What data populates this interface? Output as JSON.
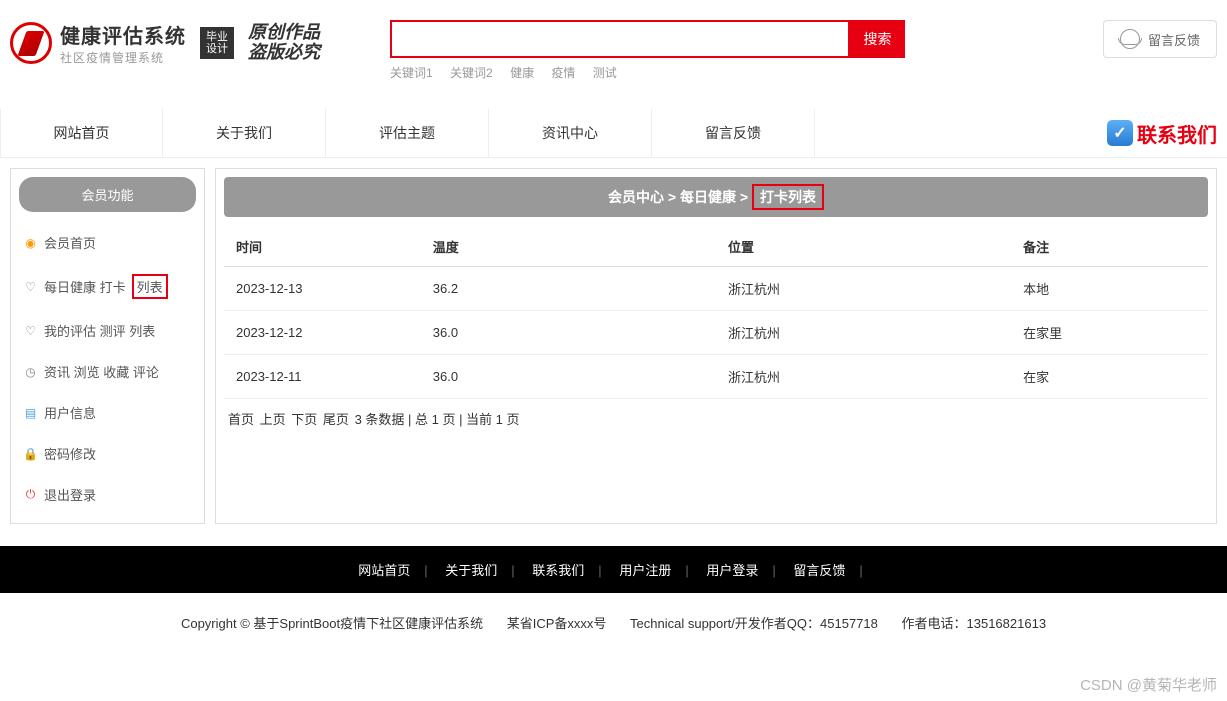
{
  "header": {
    "logo_title": "健康评估系统",
    "logo_sub": "社区疫情管理系统",
    "badge_line1": "毕业",
    "badge_line2": "设计",
    "calli_line1": "原创作品",
    "calli_line2": "盗版必究",
    "search_btn": "搜索",
    "search_placeholder": "",
    "keywords": [
      "关键词1",
      "关键词2",
      "健康",
      "疫情",
      "测试"
    ],
    "feedback": "留言反馈"
  },
  "nav": {
    "items": [
      "网站首页",
      "关于我们",
      "评估主题",
      "资讯中心",
      "留言反馈"
    ],
    "contact": "联系我们"
  },
  "sidebar": {
    "title": "会员功能",
    "items": [
      {
        "label": "会员首页"
      },
      {
        "label_pre": "每日健康 打卡",
        "label_box": "列表"
      },
      {
        "label": "我的评估 测评 列表"
      },
      {
        "label": "资讯 浏览 收藏 评论"
      },
      {
        "label": "用户信息"
      },
      {
        "label": "密码修改"
      },
      {
        "label": "退出登录"
      }
    ]
  },
  "breadcrumb": {
    "p1": "会员中心",
    "sep": " > ",
    "p2": "每日健康",
    "p3": "打卡列表"
  },
  "table": {
    "headers": [
      "时间",
      "温度",
      "位置",
      "备注"
    ],
    "rows": [
      [
        "2023-12-13",
        "36.2",
        "浙江杭州",
        "本地"
      ],
      [
        "2023-12-12",
        "36.0",
        "浙江杭州",
        "在家里"
      ],
      [
        "2023-12-11",
        "36.0",
        "浙江杭州",
        "在家"
      ]
    ]
  },
  "pager": {
    "first": "首页",
    "prev": "上页",
    "next": "下页",
    "last": "尾页",
    "info": "3 条数据 | 总 1 页 | 当前 1 页"
  },
  "footer": {
    "links": [
      "网站首页",
      "关于我们",
      "联系我们",
      "用户注册",
      "用户登录",
      "留言反馈"
    ],
    "copy_pre": "Copyright © 基于SprintBoot疫情下社区健康评估系统",
    "icp": "某省ICP备xxxx号",
    "support": "Technical support/开发作者QQ：45157718",
    "phone": "作者电话：13516821613"
  },
  "watermark": "CSDN @黄菊华老师"
}
